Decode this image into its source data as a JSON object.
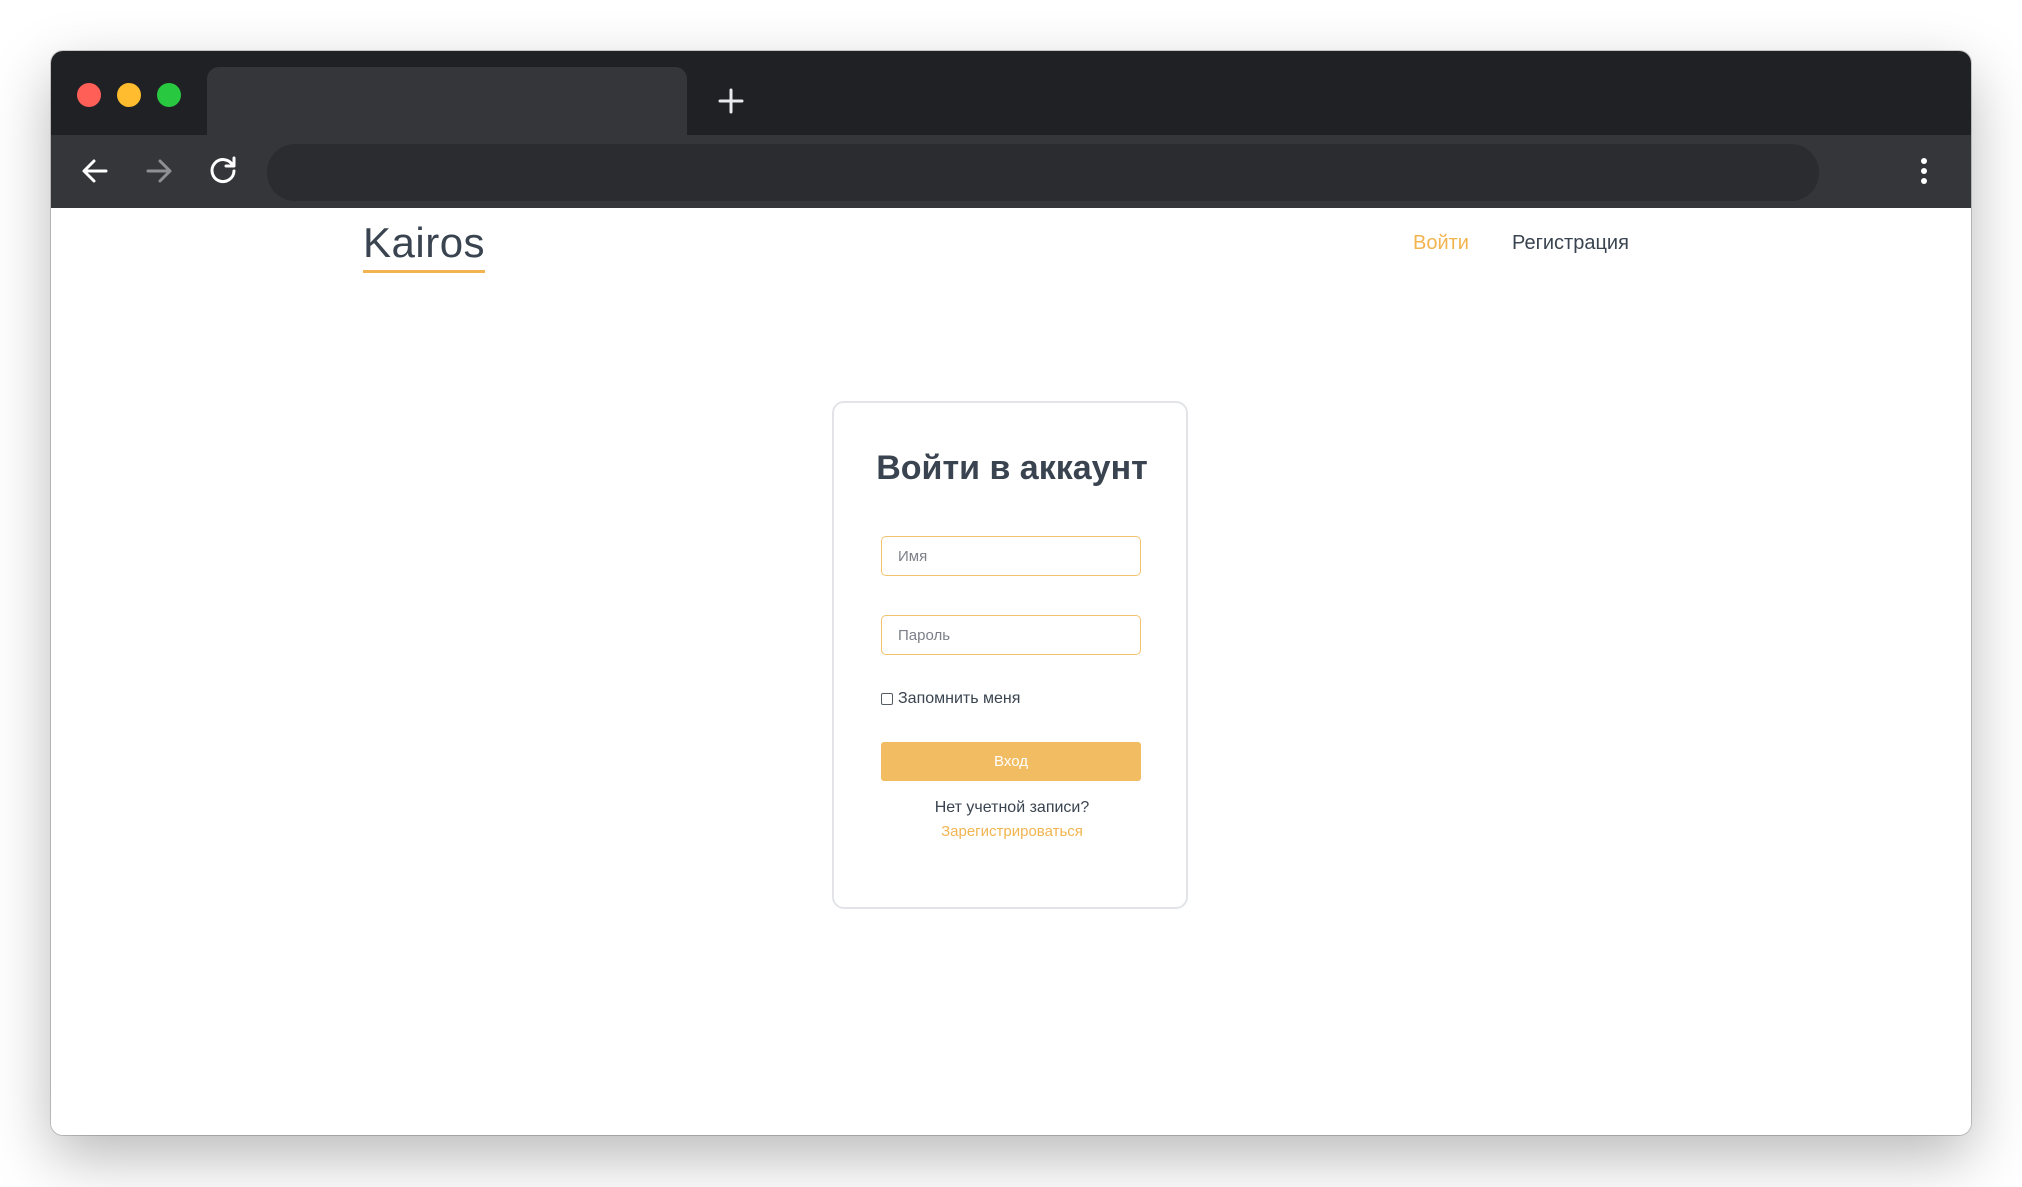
{
  "browser": {
    "tab_title": "",
    "address": "",
    "colors": {
      "tabstrip": "#202124",
      "toolbar": "#35363a",
      "omnibox": "#2b2c2f"
    }
  },
  "site": {
    "brand": "Kairos",
    "nav": {
      "login": "Войти",
      "register": "Регистрация"
    },
    "accent_color": "#f2b44f"
  },
  "login_card": {
    "title": "Войти в аккаунт",
    "name_placeholder": "Имя",
    "password_placeholder": "Пароль",
    "remember_label": "Запомнить меня",
    "remember_checked": false,
    "submit_label": "Вход",
    "no_account_text": "Нет учетной записи?",
    "signup_link": "Зарегистрироваться"
  },
  "icons": {
    "back": "arrow-left-icon",
    "forward": "arrow-right-icon",
    "reload": "reload-icon",
    "menu": "kebab-menu-icon",
    "new_tab": "plus-icon"
  }
}
